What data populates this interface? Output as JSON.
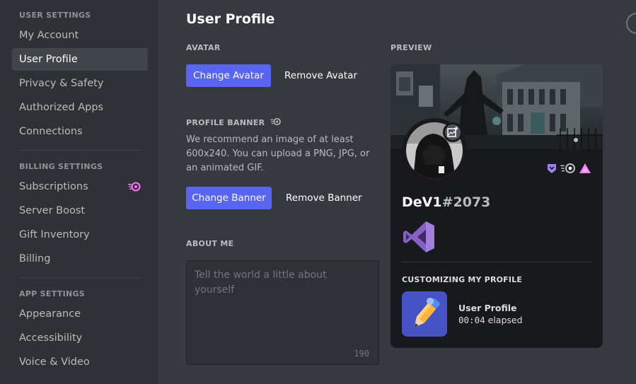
{
  "sidebar": {
    "sections": [
      {
        "title": "USER SETTINGS",
        "items": [
          {
            "label": "My Account",
            "active": false
          },
          {
            "label": "User Profile",
            "active": true
          },
          {
            "label": "Privacy & Safety",
            "active": false
          },
          {
            "label": "Authorized Apps",
            "active": false
          },
          {
            "label": "Connections",
            "active": false
          }
        ]
      },
      {
        "title": "BILLING SETTINGS",
        "items": [
          {
            "label": "Subscriptions",
            "badge": "nitro-icon"
          },
          {
            "label": "Server Boost"
          },
          {
            "label": "Gift Inventory"
          },
          {
            "label": "Billing"
          }
        ]
      },
      {
        "title": "APP SETTINGS",
        "items": [
          {
            "label": "Appearance"
          },
          {
            "label": "Accessibility"
          },
          {
            "label": "Voice & Video"
          }
        ]
      }
    ]
  },
  "main": {
    "title": "User Profile",
    "avatar": {
      "label": "AVATAR",
      "change_button": "Change Avatar",
      "remove_button": "Remove Avatar"
    },
    "banner": {
      "label": "PROFILE BANNER",
      "description": "We recommend an image of at least 600x240. You can upload a PNG, JPG, or an animated GIF.",
      "change_button": "Change Banner",
      "remove_button": "Remove Banner"
    },
    "about": {
      "label": "ABOUT ME",
      "placeholder": "Tell the world a little about yourself",
      "value": "",
      "char_count": "190"
    }
  },
  "preview": {
    "label": "PREVIEW",
    "username": "DeV1",
    "discriminator": "#2073",
    "badges": [
      "hypesquad-balance-icon",
      "nitro-icon",
      "early-supporter-icon"
    ],
    "activity": {
      "title": "CUSTOMIZING MY PROFILE",
      "name": "User Profile",
      "elapsed_time": "00:04",
      "elapsed_suffix": "elapsed"
    }
  },
  "colors": {
    "accent": "#5865f2",
    "sidebar_bg": "#2f3136",
    "main_bg": "#36393f",
    "card_bg": "#18191c",
    "nitro_pink": "#ff73fa",
    "vs_purple": "#8661c5"
  }
}
